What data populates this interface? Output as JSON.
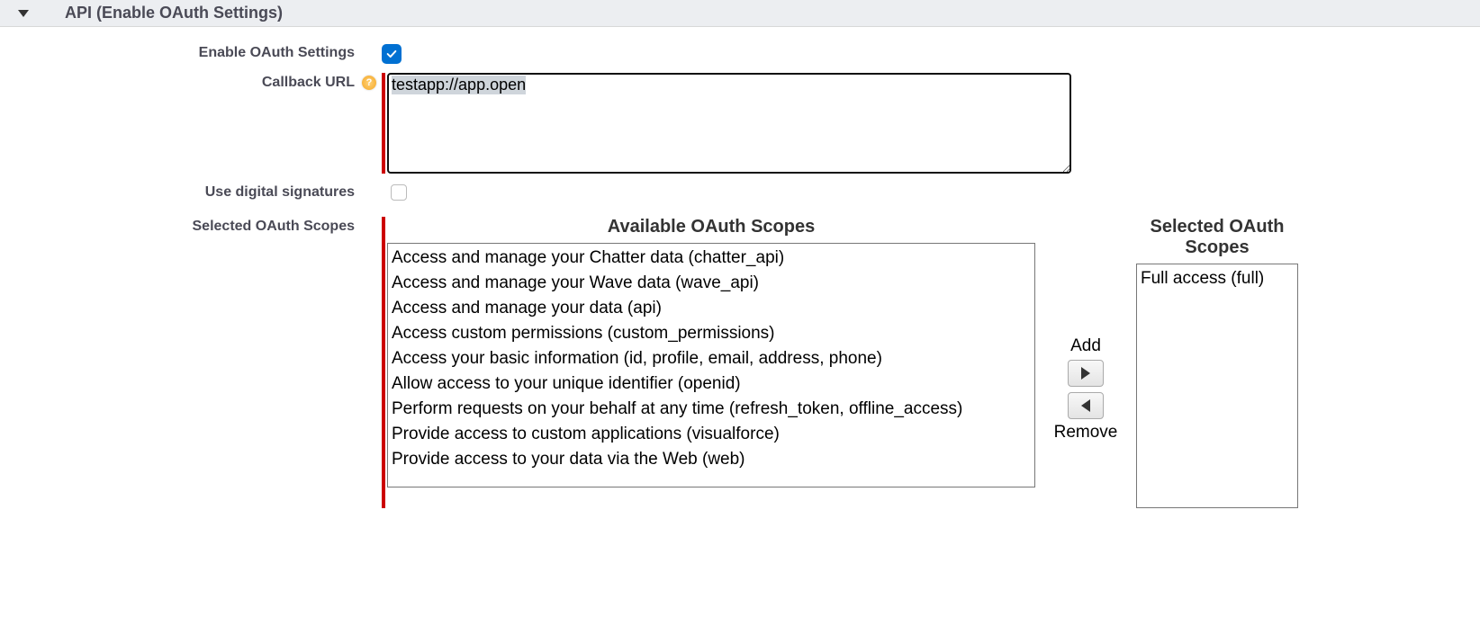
{
  "section": {
    "title": "API (Enable OAuth Settings)"
  },
  "labels": {
    "enable": "Enable OAuth Settings",
    "callback": "Callback URL",
    "digitalSig": "Use digital signatures",
    "selectedScopes": "Selected OAuth Scopes"
  },
  "callback": {
    "value": "testapp://app.open"
  },
  "enable": {
    "checked": true
  },
  "digitalSig": {
    "checked": false
  },
  "scopes": {
    "availableHeading": "Available OAuth Scopes",
    "selectedHeading": "Selected OAuth Scopes",
    "available": [
      "Access and manage your Chatter data (chatter_api)",
      "Access and manage your Wave data (wave_api)",
      "Access and manage your data (api)",
      "Access custom permissions (custom_permissions)",
      "Access your basic information (id, profile, email, address, phone)",
      "Allow access to your unique identifier (openid)",
      "Perform requests on your behalf at any time (refresh_token, offline_access)",
      "Provide access to custom applications (visualforce)",
      "Provide access to your data via the Web (web)"
    ],
    "selected": [
      "Full access (full)"
    ]
  },
  "buttons": {
    "add": "Add",
    "remove": "Remove"
  }
}
